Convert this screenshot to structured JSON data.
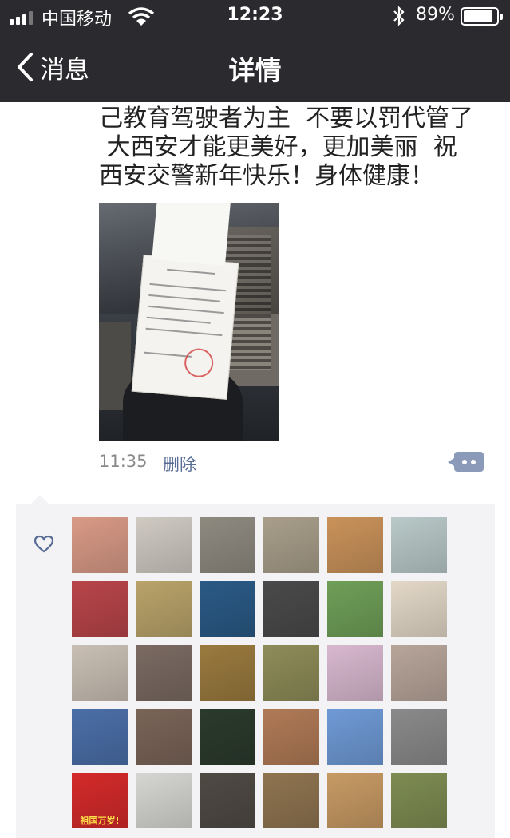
{
  "status_bar": {
    "carrier": "中国移动",
    "time": "12:23",
    "battery_percent": "89%",
    "battery_level": 0.89,
    "icons": [
      "signal-icon",
      "wifi-icon",
      "bluetooth-icon",
      "battery-icon"
    ]
  },
  "nav": {
    "back_label": "消息",
    "title": "详情",
    "back_icon": "chevron-left-icon"
  },
  "post": {
    "text": "己教育驾驶者为主  不要以罚代管了\n 大西安才能更美好，更加美丽  祝\n西安交警新年快乐！身体健康！",
    "time": "11:35",
    "delete_label": "删除",
    "more_icon": "more-dots-icon"
  },
  "likes": {
    "icon": "heart-outline-icon",
    "avatars": [
      {
        "name": "avatar-1",
        "color": "#d89a86"
      },
      {
        "name": "avatar-2",
        "color": "#cfcac2"
      },
      {
        "name": "avatar-3",
        "color": "#8e8a80"
      },
      {
        "name": "avatar-4",
        "color": "#a89e8a"
      },
      {
        "name": "avatar-5",
        "color": "#c9925a"
      },
      {
        "name": "avatar-6",
        "color": "#b9c9c8"
      },
      {
        "name": "avatar-7",
        "color": "#b8454a"
      },
      {
        "name": "avatar-8",
        "color": "#b9a36a"
      },
      {
        "name": "avatar-9",
        "color": "#2a5a86"
      },
      {
        "name": "avatar-10",
        "color": "#4a4a4a"
      },
      {
        "name": "avatar-11",
        "color": "#6f9f58"
      },
      {
        "name": "avatar-12",
        "color": "#e3d8c8"
      },
      {
        "name": "avatar-13",
        "color": "#c9bfb4"
      },
      {
        "name": "avatar-14",
        "color": "#7a6a62"
      },
      {
        "name": "avatar-15",
        "color": "#9a7a3e"
      },
      {
        "name": "avatar-16",
        "color": "#8e8c58"
      },
      {
        "name": "avatar-17",
        "color": "#d8b8cf"
      },
      {
        "name": "avatar-18",
        "color": "#b7a59a"
      },
      {
        "name": "avatar-19",
        "color": "#4b6fa8"
      },
      {
        "name": "avatar-20",
        "color": "#7a6458"
      },
      {
        "name": "avatar-21",
        "color": "#2b3a2c"
      },
      {
        "name": "avatar-22",
        "color": "#b07a56"
      },
      {
        "name": "avatar-23",
        "color": "#6f9ad6"
      },
      {
        "name": "avatar-24",
        "color": "#8a8a8a"
      },
      {
        "name": "avatar-25",
        "color": "#d42a2a",
        "label": "祖国万岁!"
      },
      {
        "name": "avatar-26",
        "color": "#d6d6d2"
      },
      {
        "name": "avatar-27",
        "color": "#4f4a44"
      },
      {
        "name": "avatar-28",
        "color": "#8f7450"
      },
      {
        "name": "avatar-29",
        "color": "#c79a64"
      },
      {
        "name": "avatar-30",
        "color": "#7e8c52"
      }
    ]
  },
  "colors": {
    "nav_background": "#2b2b2f",
    "link": "#576b95",
    "likes_background": "#f3f3f5",
    "meta_text": "#8a8a8a"
  }
}
